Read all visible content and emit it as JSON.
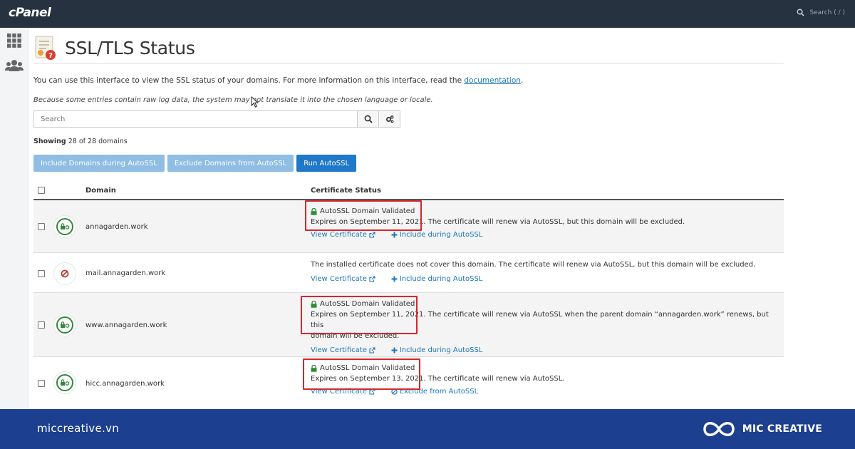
{
  "app": {
    "brand": "cPanel",
    "search_placeholder": "Search ( / )"
  },
  "page": {
    "title": "SSL/TLS Status",
    "intro_before_link": "You can use this interface to view the SSL status of your domains. For more information on this interface, read the ",
    "intro_link": "documentation",
    "intro_after_link": ".",
    "note": "Because some entries contain raw log data, the system may not translate it into the chosen language or locale.",
    "search_placeholder": "Search",
    "showing_label": "Showing",
    "showing_text": "28 of 28 domains"
  },
  "actions": {
    "include": "Include Domains during AutoSSL",
    "exclude": "Exclude Domains from AutoSSL",
    "run": "Run AutoSSL"
  },
  "table": {
    "headers": {
      "domain": "Domain",
      "status": "Certificate Status"
    },
    "rows": [
      {
        "domain": "annagarden.work",
        "validated": "AutoSSL Domain Validated",
        "expires": "Expires on September 11, 2021.",
        "message": " The certificate will renew via AutoSSL, but this domain will be excluded.",
        "message2": "",
        "link1": "View Certificate",
        "link2": "Include during AutoSSL"
      },
      {
        "domain": "mail.annagarden.work",
        "message": "The installed certificate does not cover this domain. The certificate will renew via AutoSSL, but this domain will be excluded.",
        "link1": "View Certificate",
        "link2": "Include during AutoSSL"
      },
      {
        "domain": "www.annagarden.work",
        "validated": "AutoSSL Domain Validated",
        "expires": "Expires on September 11, 2021.",
        "message": " The certificate will renew via AutoSSL when the parent domain “annagarden.work” renews, but this",
        "message2": "domain will be excluded.",
        "link1": "View Certificate",
        "link2": "Include during AutoSSL"
      },
      {
        "domain": "hicc.annagarden.work",
        "validated": "AutoSSL Domain Validated",
        "expires": "Expires on September 13, 2021.",
        "message": " The certificate will renew via AutoSSL.",
        "message2": "",
        "link1": "View Certificate",
        "link2": "Exclude from AutoSSL"
      }
    ]
  },
  "footer": {
    "site": "miccreative.vn",
    "logo_text": "MIC CREATIVE"
  },
  "colors": {
    "topbar": "#263240",
    "primary_button": "#1f78c8",
    "secondary_button": "#8fbde3",
    "link": "#1a77b8",
    "valid_green": "#2f8a3b",
    "highlight_red": "#d6262f",
    "footer": "#1c3f8f"
  },
  "icons": [
    "search-icon",
    "gears-icon",
    "grid-icon",
    "users-icon",
    "certificate-icon",
    "lock-icon",
    "external-link-icon",
    "plus-icon",
    "ban-icon"
  ]
}
